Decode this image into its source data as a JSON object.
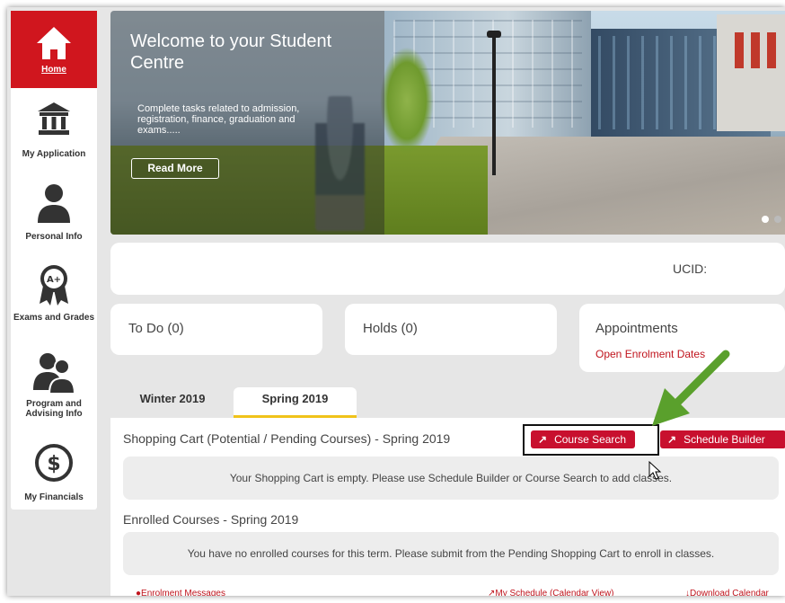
{
  "sidebar": {
    "items": [
      {
        "label": "Home",
        "icon": "home-icon",
        "active": true
      },
      {
        "label": "My Application",
        "icon": "institution-icon"
      },
      {
        "label": "Personal Info",
        "icon": "person-icon"
      },
      {
        "label": "Exams and Grades",
        "icon": "grade-medal-icon"
      },
      {
        "label": "Program and Advising Info",
        "icon": "advising-people-icon"
      },
      {
        "label": "My Financials",
        "icon": "dollar-icon"
      }
    ]
  },
  "hero": {
    "title": "Welcome to your Student Centre",
    "subtitle": "Complete tasks related to admission, registration, finance, graduation and exams.....",
    "button": "Read More"
  },
  "ucid": {
    "label": "UCID:"
  },
  "cards": {
    "todo": "To Do (0)",
    "holds": "Holds (0)",
    "appointments": {
      "title": "Appointments",
      "link": "Open Enrolment Dates"
    }
  },
  "tabs": [
    {
      "label": "Winter 2019",
      "active": false
    },
    {
      "label": "Spring 2019",
      "active": true
    }
  ],
  "shopping_cart": {
    "title": "Shopping Cart (Potential / Pending Courses) - Spring 2019",
    "empty_message": "Your Shopping Cart is empty. Please use Schedule Builder or Course Search to add classes.",
    "course_search": "Course Search",
    "schedule_builder": "Schedule Builder"
  },
  "enrolled": {
    "title": "Enrolled Courses - Spring 2019",
    "empty_message": "You have no enrolled courses for this term. Please submit from the Pending Shopping Cart to enroll in classes."
  },
  "footer": {
    "enrolment_messages": "Enrolment Messages",
    "my_schedule": "My Schedule (Calendar View)",
    "download_calendar": "Download Calendar"
  },
  "colors": {
    "brand_red": "#d0161e",
    "button_red": "#c8102e",
    "tab_underline": "#f0c31a",
    "annotation_arrow": "#5aa02c"
  }
}
